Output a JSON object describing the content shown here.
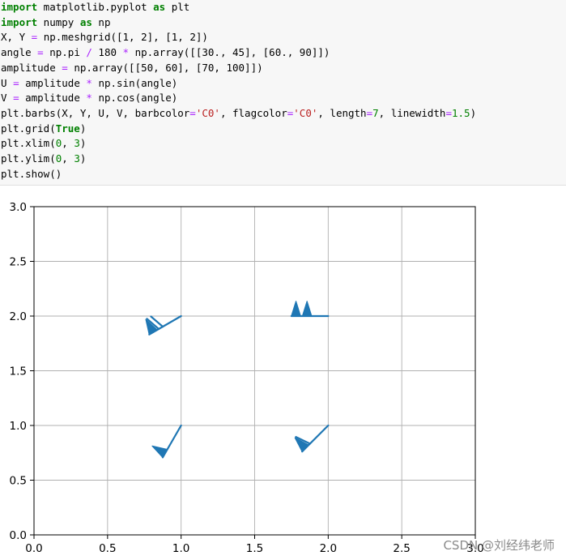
{
  "code_cell": {
    "lines": [
      [
        {
          "t": "import",
          "c": "kw"
        },
        {
          "t": " matplotlib.pyplot "
        },
        {
          "t": "as",
          "c": "kw"
        },
        {
          "t": " plt"
        }
      ],
      [
        {
          "t": "import",
          "c": "kw"
        },
        {
          "t": " numpy "
        },
        {
          "t": "as",
          "c": "kw"
        },
        {
          "t": " np"
        }
      ],
      [
        {
          "t": "X, Y "
        },
        {
          "t": "=",
          "c": "op"
        },
        {
          "t": " np.meshgrid([1, 2], [1, 2])"
        }
      ],
      [
        {
          "t": "angle "
        },
        {
          "t": "=",
          "c": "op"
        },
        {
          "t": " np.pi "
        },
        {
          "t": "/",
          "c": "op"
        },
        {
          "t": " 180 "
        },
        {
          "t": "*",
          "c": "op"
        },
        {
          "t": " np.array([[30., 45], [60., 90]])"
        }
      ],
      [
        {
          "t": "amplitude "
        },
        {
          "t": "=",
          "c": "op"
        },
        {
          "t": " np.array([[50, 60], [70, 100]])"
        }
      ],
      [
        {
          "t": "U "
        },
        {
          "t": "=",
          "c": "op"
        },
        {
          "t": " amplitude "
        },
        {
          "t": "*",
          "c": "op"
        },
        {
          "t": " np.sin(angle)"
        }
      ],
      [
        {
          "t": "V "
        },
        {
          "t": "=",
          "c": "op"
        },
        {
          "t": " amplitude "
        },
        {
          "t": "*",
          "c": "op"
        },
        {
          "t": " np.cos(angle)"
        }
      ],
      [
        {
          "t": "plt.barbs(X, Y, U, V, barbcolor"
        },
        {
          "t": "=",
          "c": "op"
        },
        {
          "t": "'C0'",
          "c": "str"
        },
        {
          "t": ", flagcolor"
        },
        {
          "t": "=",
          "c": "op"
        },
        {
          "t": "'C0'",
          "c": "str"
        },
        {
          "t": ", length"
        },
        {
          "t": "=",
          "c": "op"
        },
        {
          "t": "7",
          "c": "num"
        },
        {
          "t": ", linewidth"
        },
        {
          "t": "=",
          "c": "op"
        },
        {
          "t": "1.5",
          "c": "num"
        },
        {
          "t": ")"
        }
      ],
      [
        {
          "t": "plt.grid("
        },
        {
          "t": "True",
          "c": "kw"
        },
        {
          "t": ")"
        }
      ],
      [
        {
          "t": "plt.xlim("
        },
        {
          "t": "0",
          "c": "num"
        },
        {
          "t": ", "
        },
        {
          "t": "3",
          "c": "num"
        },
        {
          "t": ")"
        }
      ],
      [
        {
          "t": "plt.ylim("
        },
        {
          "t": "0",
          "c": "num"
        },
        {
          "t": ", "
        },
        {
          "t": "3",
          "c": "num"
        },
        {
          "t": ")"
        }
      ],
      [
        {
          "t": "plt.show()"
        }
      ]
    ]
  },
  "chart_data": {
    "type": "barbs",
    "xlim": [
      0,
      3
    ],
    "ylim": [
      0,
      3
    ],
    "xticks": [
      "0.0",
      "0.5",
      "1.0",
      "1.5",
      "2.0",
      "2.5",
      "3.0"
    ],
    "yticks": [
      "0.0",
      "0.5",
      "1.0",
      "1.5",
      "2.0",
      "2.5",
      "3.0"
    ],
    "grid": true,
    "color": "#1f77b4",
    "barbs": [
      {
        "x": 1,
        "y": 1,
        "angle_deg": 30,
        "amplitude": 50
      },
      {
        "x": 2,
        "y": 1,
        "angle_deg": 45,
        "amplitude": 60
      },
      {
        "x": 1,
        "y": 2,
        "angle_deg": 60,
        "amplitude": 70
      },
      {
        "x": 2,
        "y": 2,
        "angle_deg": 90,
        "amplitude": 100
      }
    ]
  },
  "watermark": "CSDN @刘经纬老师"
}
